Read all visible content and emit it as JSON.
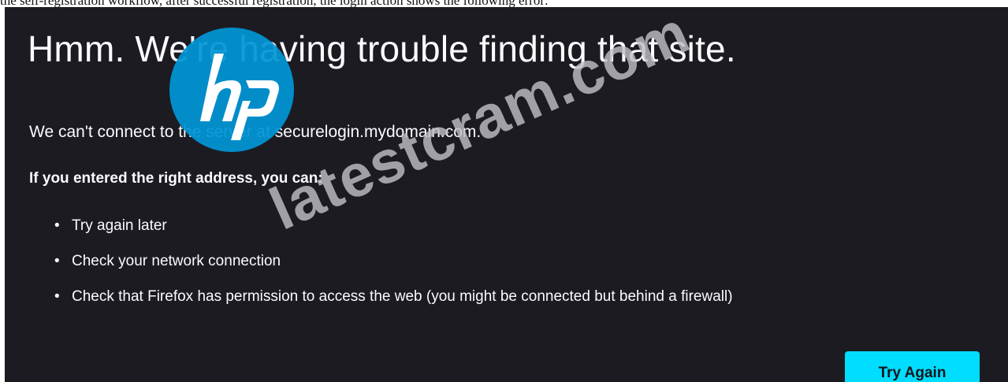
{
  "document": {
    "caption": "the self-registration workflow, after successful registration, the login action shows the following error:"
  },
  "error_page": {
    "title": "Hmm. We're having trouble finding that site.",
    "message": "We can't connect to the server at securelogin.mydomain.com.",
    "prompt": "If you entered the right address, you can:",
    "bullet": "•",
    "suggestions": [
      "Try again later",
      "Check your network connection",
      "Check that Firefox has permission to access the web (you might be connected but behind a firewall)"
    ],
    "try_again_label": "Try Again"
  },
  "overlay": {
    "logo_text": "hp",
    "watermark_text": "latestcram.com"
  },
  "colors": {
    "page_background": "#1c1b22",
    "text": "#fbfbfe",
    "button_background": "#00ddff",
    "logo": "#0096d6",
    "watermark": "#bebec3"
  }
}
